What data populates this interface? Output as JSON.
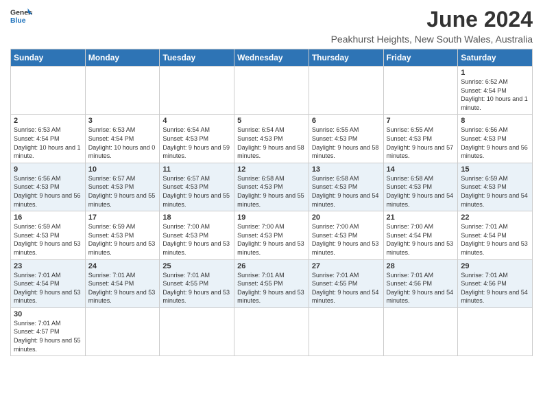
{
  "header": {
    "logo_general": "General",
    "logo_blue": "Blue",
    "title": "June 2024",
    "subtitle": "Peakhurst Heights, New South Wales, Australia"
  },
  "days_of_week": [
    "Sunday",
    "Monday",
    "Tuesday",
    "Wednesday",
    "Thursday",
    "Friday",
    "Saturday"
  ],
  "weeks": [
    {
      "alt": false,
      "days": [
        {
          "num": "",
          "info": ""
        },
        {
          "num": "",
          "info": ""
        },
        {
          "num": "",
          "info": ""
        },
        {
          "num": "",
          "info": ""
        },
        {
          "num": "",
          "info": ""
        },
        {
          "num": "",
          "info": ""
        },
        {
          "num": "1",
          "info": "Sunrise: 6:52 AM\nSunset: 4:54 PM\nDaylight: 10 hours and 1 minute."
        }
      ]
    },
    {
      "alt": false,
      "days": [
        {
          "num": "2",
          "info": "Sunrise: 6:53 AM\nSunset: 4:54 PM\nDaylight: 10 hours and 1 minute."
        },
        {
          "num": "3",
          "info": "Sunrise: 6:53 AM\nSunset: 4:54 PM\nDaylight: 10 hours and 0 minutes."
        },
        {
          "num": "4",
          "info": "Sunrise: 6:54 AM\nSunset: 4:53 PM\nDaylight: 9 hours and 59 minutes."
        },
        {
          "num": "5",
          "info": "Sunrise: 6:54 AM\nSunset: 4:53 PM\nDaylight: 9 hours and 58 minutes."
        },
        {
          "num": "6",
          "info": "Sunrise: 6:55 AM\nSunset: 4:53 PM\nDaylight: 9 hours and 58 minutes."
        },
        {
          "num": "7",
          "info": "Sunrise: 6:55 AM\nSunset: 4:53 PM\nDaylight: 9 hours and 57 minutes."
        },
        {
          "num": "8",
          "info": "Sunrise: 6:56 AM\nSunset: 4:53 PM\nDaylight: 9 hours and 56 minutes."
        }
      ]
    },
    {
      "alt": true,
      "days": [
        {
          "num": "9",
          "info": "Sunrise: 6:56 AM\nSunset: 4:53 PM\nDaylight: 9 hours and 56 minutes."
        },
        {
          "num": "10",
          "info": "Sunrise: 6:57 AM\nSunset: 4:53 PM\nDaylight: 9 hours and 55 minutes."
        },
        {
          "num": "11",
          "info": "Sunrise: 6:57 AM\nSunset: 4:53 PM\nDaylight: 9 hours and 55 minutes."
        },
        {
          "num": "12",
          "info": "Sunrise: 6:58 AM\nSunset: 4:53 PM\nDaylight: 9 hours and 55 minutes."
        },
        {
          "num": "13",
          "info": "Sunrise: 6:58 AM\nSunset: 4:53 PM\nDaylight: 9 hours and 54 minutes."
        },
        {
          "num": "14",
          "info": "Sunrise: 6:58 AM\nSunset: 4:53 PM\nDaylight: 9 hours and 54 minutes."
        },
        {
          "num": "15",
          "info": "Sunrise: 6:59 AM\nSunset: 4:53 PM\nDaylight: 9 hours and 54 minutes."
        }
      ]
    },
    {
      "alt": false,
      "days": [
        {
          "num": "16",
          "info": "Sunrise: 6:59 AM\nSunset: 4:53 PM\nDaylight: 9 hours and 53 minutes."
        },
        {
          "num": "17",
          "info": "Sunrise: 6:59 AM\nSunset: 4:53 PM\nDaylight: 9 hours and 53 minutes."
        },
        {
          "num": "18",
          "info": "Sunrise: 7:00 AM\nSunset: 4:53 PM\nDaylight: 9 hours and 53 minutes."
        },
        {
          "num": "19",
          "info": "Sunrise: 7:00 AM\nSunset: 4:53 PM\nDaylight: 9 hours and 53 minutes."
        },
        {
          "num": "20",
          "info": "Sunrise: 7:00 AM\nSunset: 4:53 PM\nDaylight: 9 hours and 53 minutes."
        },
        {
          "num": "21",
          "info": "Sunrise: 7:00 AM\nSunset: 4:54 PM\nDaylight: 9 hours and 53 minutes."
        },
        {
          "num": "22",
          "info": "Sunrise: 7:01 AM\nSunset: 4:54 PM\nDaylight: 9 hours and 53 minutes."
        }
      ]
    },
    {
      "alt": true,
      "days": [
        {
          "num": "23",
          "info": "Sunrise: 7:01 AM\nSunset: 4:54 PM\nDaylight: 9 hours and 53 minutes."
        },
        {
          "num": "24",
          "info": "Sunrise: 7:01 AM\nSunset: 4:54 PM\nDaylight: 9 hours and 53 minutes."
        },
        {
          "num": "25",
          "info": "Sunrise: 7:01 AM\nSunset: 4:55 PM\nDaylight: 9 hours and 53 minutes."
        },
        {
          "num": "26",
          "info": "Sunrise: 7:01 AM\nSunset: 4:55 PM\nDaylight: 9 hours and 53 minutes."
        },
        {
          "num": "27",
          "info": "Sunrise: 7:01 AM\nSunset: 4:55 PM\nDaylight: 9 hours and 54 minutes."
        },
        {
          "num": "28",
          "info": "Sunrise: 7:01 AM\nSunset: 4:56 PM\nDaylight: 9 hours and 54 minutes."
        },
        {
          "num": "29",
          "info": "Sunrise: 7:01 AM\nSunset: 4:56 PM\nDaylight: 9 hours and 54 minutes."
        }
      ]
    },
    {
      "alt": false,
      "days": [
        {
          "num": "30",
          "info": "Sunrise: 7:01 AM\nSunset: 4:57 PM\nDaylight: 9 hours and 55 minutes."
        },
        {
          "num": "",
          "info": ""
        },
        {
          "num": "",
          "info": ""
        },
        {
          "num": "",
          "info": ""
        },
        {
          "num": "",
          "info": ""
        },
        {
          "num": "",
          "info": ""
        },
        {
          "num": "",
          "info": ""
        }
      ]
    }
  ]
}
